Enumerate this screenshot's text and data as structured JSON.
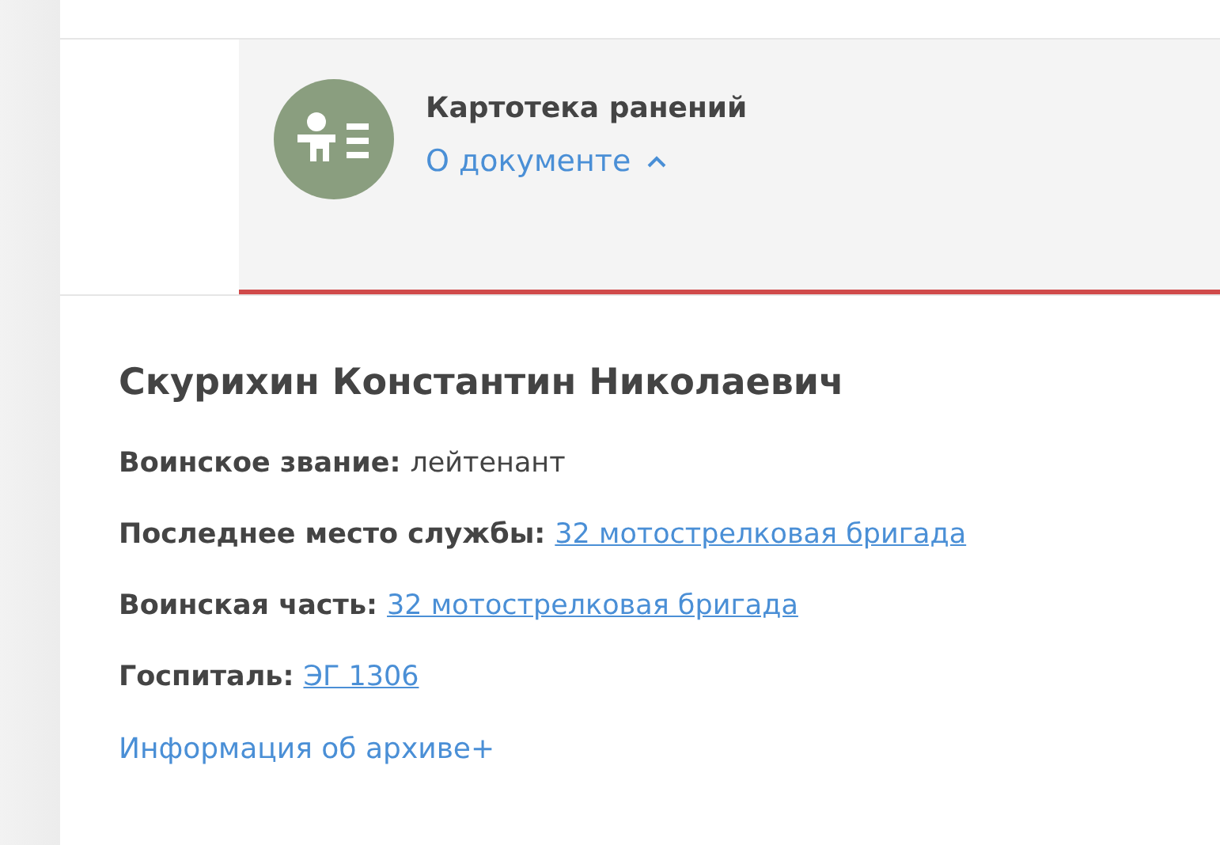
{
  "document": {
    "title": "Картотека ранений",
    "toggle": {
      "label": "О документе",
      "expanded": true
    }
  },
  "person": {
    "name": "Скурихин Константин Николаевич",
    "fields": [
      {
        "label": "Воинское звание:",
        "value": "лейтенант",
        "kind": "text"
      },
      {
        "label": "Последнее место службы:",
        "value": "32 мотострелковая бригада",
        "kind": "link"
      },
      {
        "label": "Воинская часть:",
        "value": "32 мотострелковая бригада",
        "kind": "link"
      },
      {
        "label": "Госпиталь:",
        "value": "ЭГ 1306",
        "kind": "link"
      }
    ],
    "archive_link": "Информация об архиве+"
  }
}
